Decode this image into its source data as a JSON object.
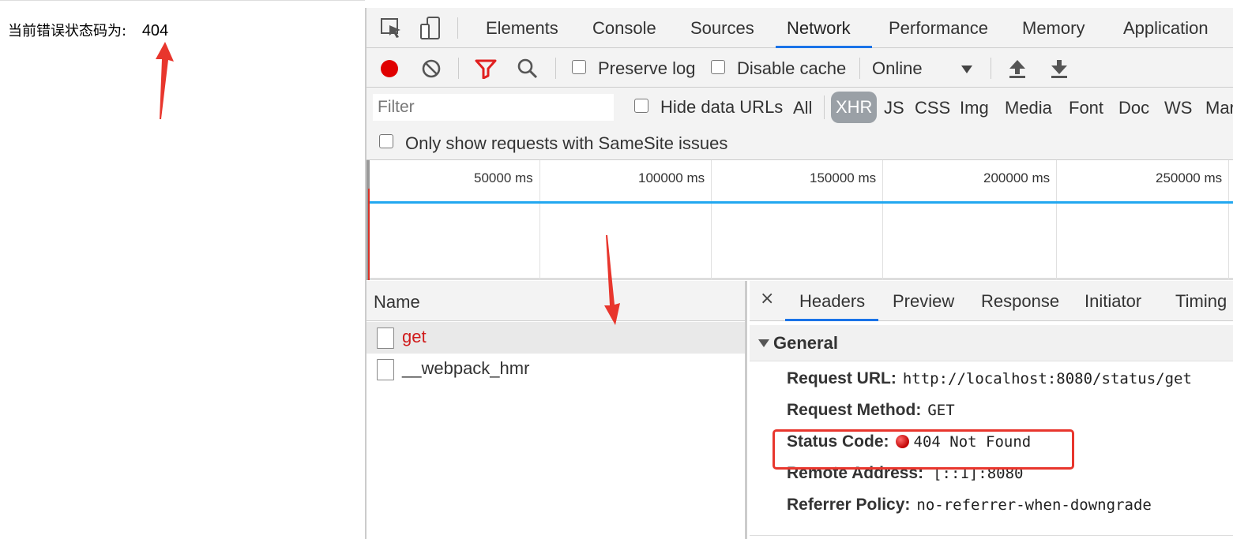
{
  "page": {
    "status_label": "当前错误状态码为:",
    "status_code": "404"
  },
  "devtools": {
    "tabs": [
      "Elements",
      "Console",
      "Sources",
      "Network",
      "Performance",
      "Memory",
      "Application"
    ],
    "active_tab": "Network",
    "toolbar": {
      "preserve_log": "Preserve log",
      "disable_cache": "Disable cache",
      "throttling": "Online"
    },
    "filter": {
      "placeholder": "Filter",
      "hide_data_urls": "Hide data URLs",
      "types": [
        "All",
        "XHR",
        "JS",
        "CSS",
        "Img",
        "Media",
        "Font",
        "Doc",
        "WS",
        "Mar"
      ],
      "active_type": "XHR",
      "samesite": "Only show requests with SameSite issues"
    },
    "timeline": {
      "ticks": [
        "50000 ms",
        "100000 ms",
        "150000 ms",
        "200000 ms",
        "250000 ms"
      ]
    },
    "requests": {
      "column_name": "Name",
      "rows": [
        {
          "name": "get",
          "status": "error"
        },
        {
          "name": "__webpack_hmr",
          "status": "ok"
        }
      ]
    },
    "details": {
      "close": "×",
      "tabs": [
        "Headers",
        "Preview",
        "Response",
        "Initiator",
        "Timing"
      ],
      "active_tab": "Headers",
      "section_title": "General",
      "fields": [
        {
          "key": "Request URL:",
          "value": "http://localhost:8080/status/get"
        },
        {
          "key": "Request Method:",
          "value": "GET"
        },
        {
          "key": "Status Code:",
          "value": "404 Not Found"
        },
        {
          "key": "Remote Address:",
          "value": "[::1]:8080"
        },
        {
          "key": "Referrer Policy:",
          "value": "no-referrer-when-downgrade"
        }
      ]
    }
  },
  "colors": {
    "record_red": "#e00000",
    "filter_red": "#e02020",
    "active_blue": "#1a73e8",
    "timeline_blue": "#22a7f0",
    "error_text": "#d01c1c",
    "annotation_red": "#e8362d"
  }
}
